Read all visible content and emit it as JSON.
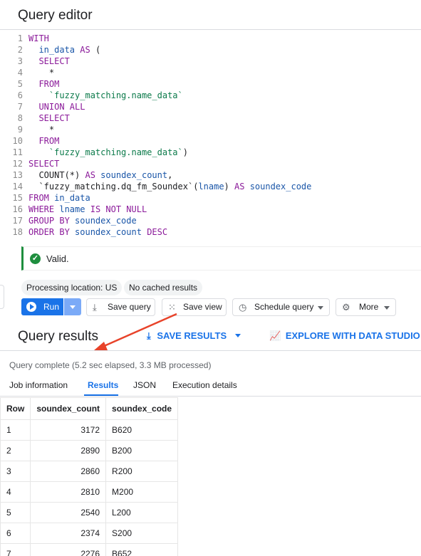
{
  "editor": {
    "title": "Query editor",
    "line_numbers": [
      "1",
      "2",
      "3",
      "4",
      "5",
      "6",
      "7",
      "8",
      "9",
      "10",
      "11",
      "12",
      "13",
      "14",
      "15",
      "16",
      "17",
      "18"
    ]
  },
  "validation": {
    "text": "Valid."
  },
  "chips": {
    "location": "Processing location: US",
    "cache": "No cached results"
  },
  "toolbar": {
    "run": "Run",
    "save_query": "Save query",
    "save_view": "Save view",
    "schedule_query": "Schedule query",
    "more": "More"
  },
  "results": {
    "title": "Query results",
    "save_results": "SAVE RESULTS",
    "explore": "EXPLORE WITH DATA STUDIO",
    "status": "Query complete (5.2 sec elapsed, 3.3 MB processed)",
    "tabs": [
      "Job information",
      "Results",
      "JSON",
      "Execution details"
    ],
    "active_tab": "Results",
    "columns": [
      "Row",
      "soundex_count",
      "soundex_code"
    ],
    "rows": [
      [
        "1",
        "3172",
        "B620"
      ],
      [
        "2",
        "2890",
        "B200"
      ],
      [
        "3",
        "2860",
        "R200"
      ],
      [
        "4",
        "2810",
        "M200"
      ],
      [
        "5",
        "2540",
        "L200"
      ],
      [
        "6",
        "2374",
        "S200"
      ],
      [
        "7",
        "2276",
        "B652"
      ]
    ]
  },
  "colors": {
    "accent": "#1a73e8",
    "valid": "#1e8e3e",
    "arrow": "#e8432a"
  }
}
